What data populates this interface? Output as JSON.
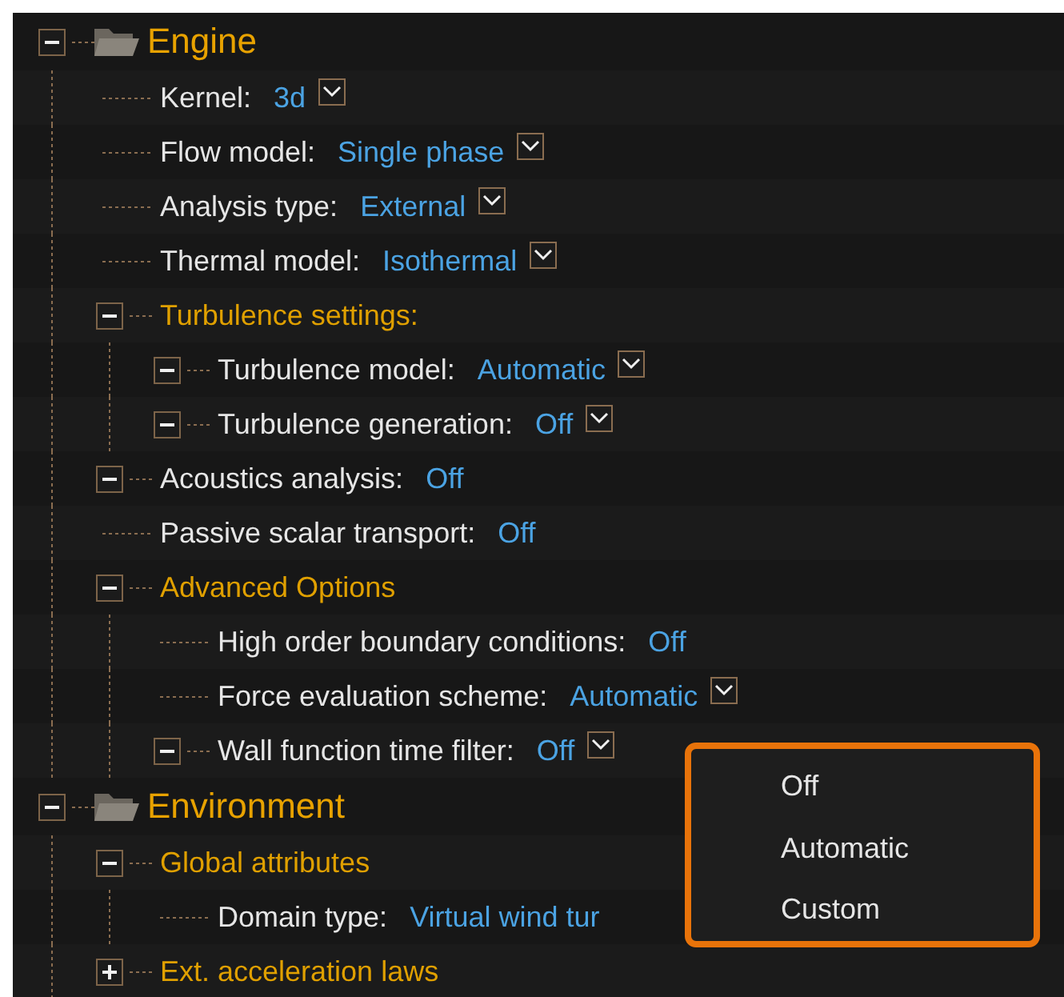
{
  "tree": [
    {
      "kind": "category",
      "label": "Engine",
      "expanded": true,
      "children": [
        {
          "kind": "setting",
          "label": "Kernel:",
          "value": "3d",
          "dropdown": true
        },
        {
          "kind": "setting",
          "label": "Flow model:",
          "value": "Single phase",
          "dropdown": true
        },
        {
          "kind": "setting",
          "label": "Analysis type:",
          "value": "External",
          "dropdown": true
        },
        {
          "kind": "setting",
          "label": "Thermal model:",
          "value": "Isothermal",
          "dropdown": true
        },
        {
          "kind": "group",
          "label": "Turbulence settings:",
          "expanded": true,
          "children": [
            {
              "kind": "setting",
              "label": "Turbulence model:",
              "value": "Automatic",
              "dropdown": true,
              "expanded": true
            },
            {
              "kind": "setting",
              "label": "Turbulence generation:",
              "value": "Off",
              "dropdown": true,
              "expanded": true
            }
          ]
        },
        {
          "kind": "setting",
          "label": "Acoustics analysis:",
          "value": "Off",
          "expanded": true
        },
        {
          "kind": "setting",
          "label": "Passive scalar transport:",
          "value": "Off"
        },
        {
          "kind": "group",
          "label": "Advanced Options",
          "expanded": true,
          "children": [
            {
              "kind": "setting",
              "label": "High order boundary conditions:",
              "value": "Off"
            },
            {
              "kind": "setting",
              "label": "Force evaluation scheme:",
              "value": "Automatic",
              "dropdown": true
            },
            {
              "kind": "setting",
              "label": "Wall function time filter:",
              "value": "Off",
              "dropdown": true,
              "expanded": true
            }
          ]
        }
      ]
    },
    {
      "kind": "category",
      "label": "Environment",
      "expanded": true,
      "children": [
        {
          "kind": "group",
          "label": "Global attributes",
          "expanded": true,
          "children": [
            {
              "kind": "setting",
              "label": "Domain type:",
              "value": "Virtual wind tur"
            }
          ]
        },
        {
          "kind": "group",
          "label": "Ext. acceleration laws",
          "expanded": false
        }
      ]
    }
  ],
  "dropdown_menu": {
    "items": [
      "Off",
      "Automatic",
      "Custom"
    ]
  }
}
